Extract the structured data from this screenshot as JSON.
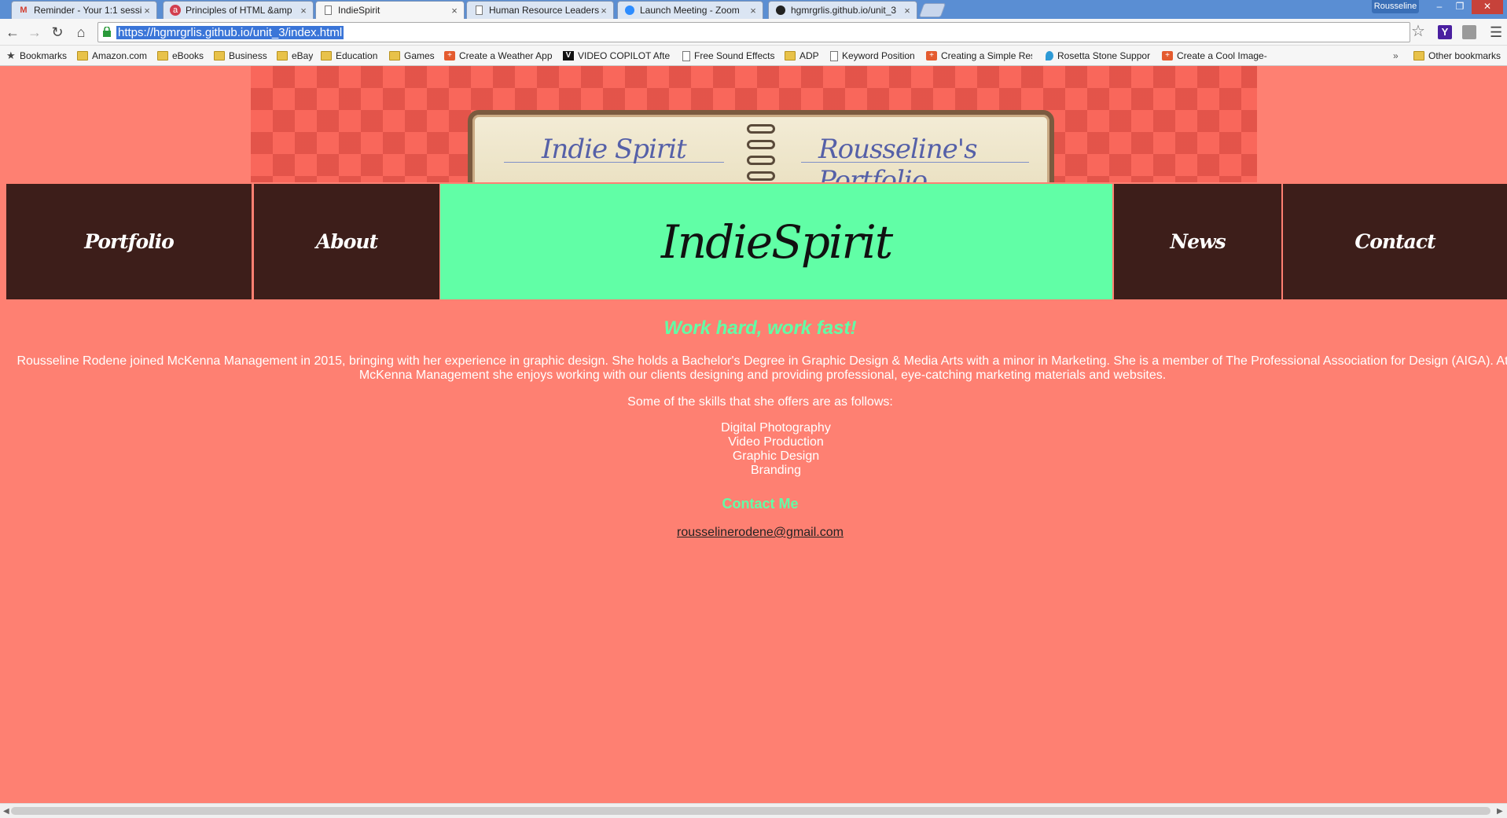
{
  "browser": {
    "tabs": [
      {
        "title": "Reminder - Your 1:1 sessi",
        "icon": "gmail-icon",
        "active": false
      },
      {
        "title": "Principles of HTML &amp",
        "icon": "course-icon",
        "active": false
      },
      {
        "title": "IndieSpirit",
        "icon": "page-icon",
        "active": true
      },
      {
        "title": "Human Resource Leaders",
        "icon": "page-icon",
        "active": false
      },
      {
        "title": "Launch Meeting - Zoom",
        "icon": "zoom-icon",
        "active": false
      },
      {
        "title": "hgmrgrlis.github.io/unit_3",
        "icon": "github-icon",
        "active": false
      }
    ],
    "profile_name": "Rousseline",
    "url": "https://hgmrgrlis.github.io/unit_3/index.html",
    "bookmarks": [
      {
        "label": "Bookmarks",
        "icon": "star-icon"
      },
      {
        "label": "Amazon.com",
        "icon": "folder-icon"
      },
      {
        "label": "eBooks",
        "icon": "folder-icon"
      },
      {
        "label": "Business",
        "icon": "folder-icon"
      },
      {
        "label": "eBay",
        "icon": "folder-icon"
      },
      {
        "label": "Education",
        "icon": "folder-icon"
      },
      {
        "label": "Games",
        "icon": "folder-icon"
      },
      {
        "label": "Create a Weather App",
        "icon": "plus-icon"
      },
      {
        "label": "VIDEO COPILOT  Afte",
        "icon": "v-icon"
      },
      {
        "label": "Free Sound Effects",
        "icon": "page-icon"
      },
      {
        "label": "ADP",
        "icon": "folder-icon"
      },
      {
        "label": "Keyword Position",
        "icon": "page-icon"
      },
      {
        "label": "Creating a Simple Res",
        "icon": "plus-icon"
      },
      {
        "label": "Rosetta Stone Suppor",
        "icon": "rosetta-icon"
      },
      {
        "label": "Create a Cool Image-",
        "icon": "plus-icon"
      }
    ],
    "overflow_chevron": "»",
    "other_bookmarks": "Other bookmarks"
  },
  "page": {
    "banner": {
      "left_text": "Indie Spirit",
      "right_text": "Rousseline's Portfolio"
    },
    "nav": {
      "portfolio": "Portfolio",
      "about": "About",
      "brand": "IndieSpirit",
      "news": "News",
      "contact": "Contact"
    },
    "tagline": "Work hard, work fast!",
    "bio_line1": "Rousseline Rodene joined McKenna Management in 2015, bringing with her experience in graphic design. She holds a Bachelor's Degree in Graphic Design & Media Arts with a minor in Marketing. She is a member of The Professional Association for Design (AIGA). At",
    "bio_line2": "McKenna Management she enjoys working with our clients designing and providing professional, eye-catching marketing materials and websites.",
    "skills_intro": "Some of the skills that she offers are as follows:",
    "skills": [
      "Digital Photography",
      "Video Production",
      "Graphic Design",
      "Branding"
    ],
    "contact_heading": "Contact Me",
    "email": "rousselinerodene@gmail.com"
  },
  "colors": {
    "page_bg": "#fe8072",
    "nav_dark": "#3d1e1a",
    "nav_accent": "#61fea6",
    "heading_green": "#61fea6"
  }
}
